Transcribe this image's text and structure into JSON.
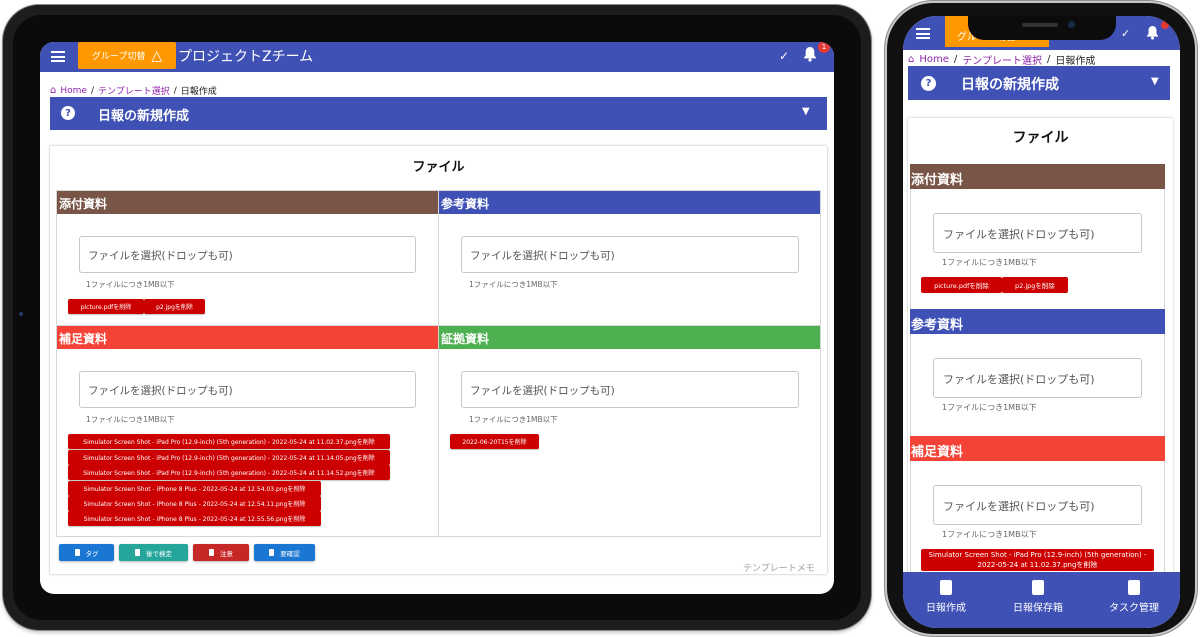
{
  "app": {
    "group_switch_label": "グループ切替",
    "group_switch_icon": "warning-triangle-icon",
    "team_name": "プロジェクトZチーム",
    "check_icon": "✓",
    "notification_count": "1"
  },
  "breadcrumb": {
    "home": "Home",
    "separator": "/",
    "template_select": "テンプレート選択",
    "current": "日報作成"
  },
  "page_header": {
    "title": "日報の新規作成",
    "help_icon": "?",
    "expand_icon": "⌄"
  },
  "card": {
    "title": "ファイル"
  },
  "sections": {
    "attached": {
      "title": "添付資料",
      "color": "#795548",
      "placeholder": "ファイルを選択(ドロップも可)",
      "hint": "1ファイルにつき1MB以下",
      "files": [
        "picture.pdfを削除",
        "p2.jpgを削除"
      ]
    },
    "reference": {
      "title": "参考資料",
      "color": "#3f51b5",
      "placeholder": "ファイルを選択(ドロップも可)",
      "hint": "1ファイルにつき1MB以下",
      "files": []
    },
    "supplement": {
      "title": "補足資料",
      "color": "#f44336",
      "placeholder": "ファイルを選択(ドロップも可)",
      "hint": "1ファイルにつき1MB以下",
      "files": [
        "Simulator Screen Shot - iPad Pro (12.9-inch) (5th generation) - 2022-05-24 at 11.02.37.pngを削除",
        "Simulator Screen Shot - iPad Pro (12.9-inch) (5th generation) - 2022-05-24 at 11.14.05.pngを削除",
        "Simulator Screen Shot - iPad Pro (12.9-inch) (5th generation) - 2022-05-24 at 11.14.52.pngを削除",
        "Simulator Screen Shot - iPhone 8 Plus - 2022-05-24 at 12.54.03.pngを削除",
        "Simulator Screen Shot - iPhone 8 Plus - 2022-05-24 at 12.54.11.pngを削除",
        "Simulator Screen Shot - iPhone 8 Plus - 2022-05-24 at 12.55.56.pngを削除"
      ]
    },
    "evidence": {
      "title": "証拠資料",
      "color": "#4caf50",
      "placeholder": "ファイルを選択(ドロップも可)",
      "hint": "1ファイルにつき1MB以下",
      "files": [
        "2022-06-20T15を削除"
      ]
    }
  },
  "action_buttons": [
    {
      "label": "タグ",
      "color": "#1976d2"
    },
    {
      "label": "後で検定",
      "color": "#26a69a"
    },
    {
      "label": "注意",
      "color": "#c62828"
    },
    {
      "label": "要確認",
      "color": "#1976d2"
    }
  ],
  "template_memo": "テンプレートメモ",
  "phone": {
    "group_switch_label": "グループ切替",
    "supplement_first_file_line1": "Simulator Screen Shot - iPad Pro (12.9-inch) (5th generation) -",
    "supplement_first_file_line2": "2022-05-24 at 11.02.37.pngを削除",
    "bottom_nav": [
      {
        "label": "日報作成",
        "icon": "file-add-icon"
      },
      {
        "label": "日報保存箱",
        "icon": "archive-box-icon"
      },
      {
        "label": "タスク管理",
        "icon": "task-settings-icon"
      }
    ]
  }
}
